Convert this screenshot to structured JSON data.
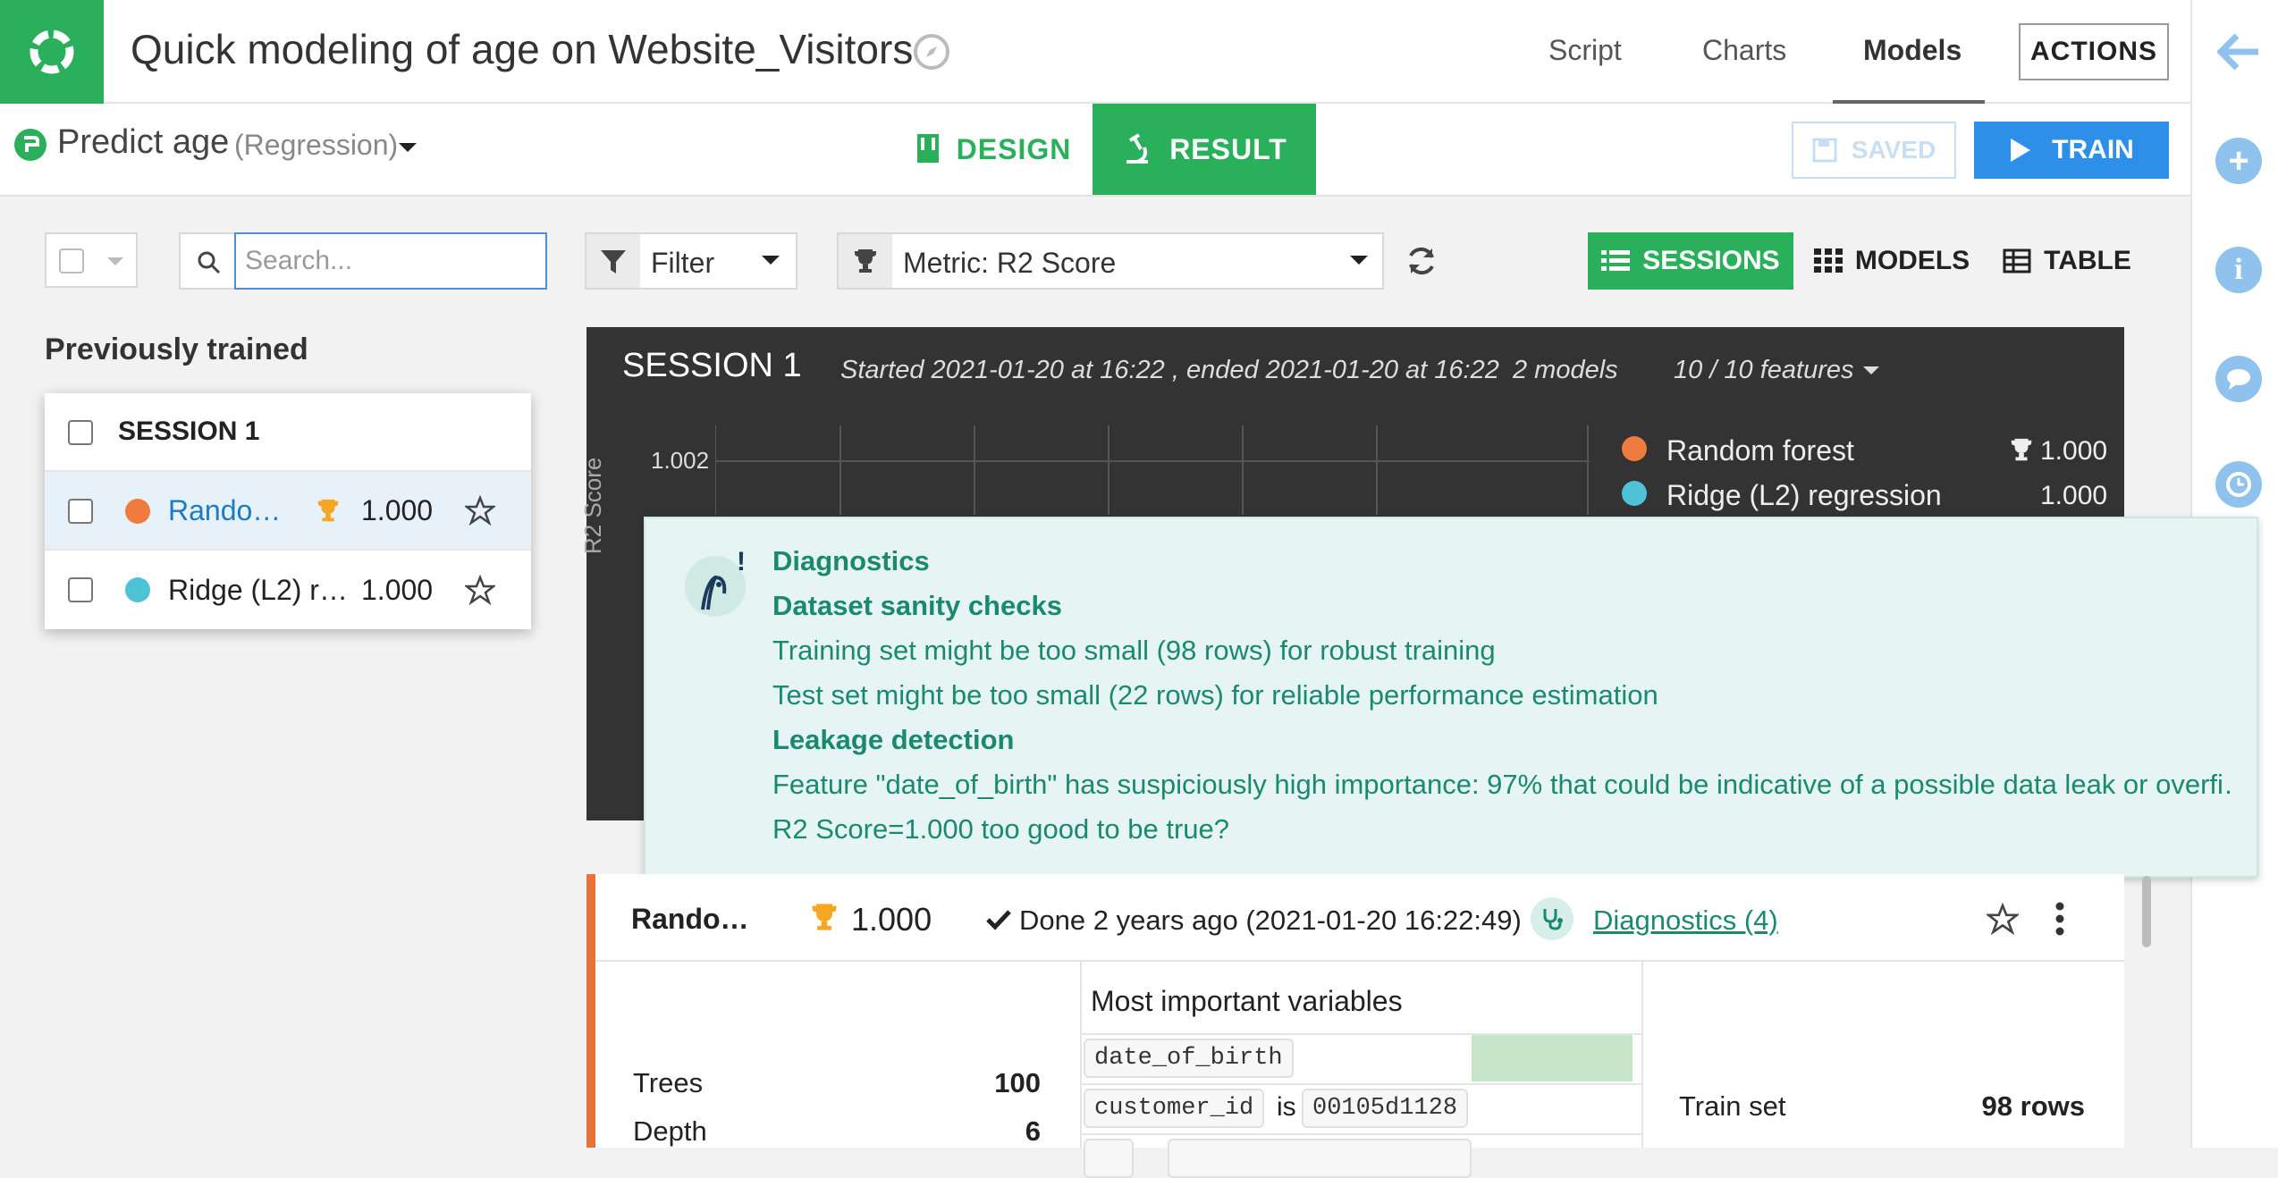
{
  "header": {
    "title": "Quick modeling of age on Website_Visitors",
    "nav": [
      "Script",
      "Charts",
      "Models"
    ],
    "actions_label": "ACTIONS"
  },
  "subheader": {
    "task_title": "Predict age",
    "task_type": "(Regression)",
    "design_label": "DESIGN",
    "result_label": "RESULT",
    "saved_label": "SAVED",
    "train_label": "TRAIN"
  },
  "toolbar": {
    "search_placeholder": "Search...",
    "filter_label": "Filter",
    "metric_label": "Metric: R2 Score",
    "sessions_label": "SESSIONS",
    "models_label": "MODELS",
    "table_label": "TABLE"
  },
  "left_panel": {
    "heading": "Previously trained",
    "session_label": "SESSION 1",
    "models": [
      {
        "name": "Rando…",
        "score": "1.000",
        "color": "#f07b3f",
        "best": true
      },
      {
        "name": "Ridge (L2) r…",
        "score": "1.000",
        "color": "#4fc3d6",
        "best": false
      }
    ]
  },
  "session": {
    "title": "SESSION 1",
    "time": "Started 2021-01-20 at 16:22 , ended 2021-01-20 at 16:22",
    "model_count": "2 models",
    "features": "10 / 10 features",
    "y_tick": "1.002",
    "y_label": "R2 Score",
    "legend": [
      {
        "name": "Random forest",
        "value": "1.000",
        "color": "#f07b3f"
      },
      {
        "name": "Ridge (L2) regression",
        "value": "1.000",
        "color": "#4fc3d6"
      }
    ]
  },
  "diagnostics": {
    "heading": "Diagnostics",
    "section1": "Dataset sanity checks",
    "line1": "Training set might be too small (98 rows) for robust training",
    "line2": "Test set might be too small (22 rows) for reliable performance estimation",
    "section2": "Leakage detection",
    "line3": "Feature \"date_of_birth\" has suspiciously high importance: 97% that could be indicative of a possible data leak or overfi…",
    "line4": "R2 Score=1.000 too good to be true?"
  },
  "model_card": {
    "name": "Rando…",
    "score": "1.000",
    "status": "Done 2 years ago (2021-01-20 16:22:49)",
    "diagnostics_link": "Diagnostics (4)",
    "params": [
      {
        "key": "Trees",
        "value": "100"
      },
      {
        "key": "Depth",
        "value": "6"
      }
    ],
    "miv_title": "Most important variables",
    "miv_var1": "date_of_birth",
    "miv_var2": "customer_id",
    "miv_is": "is",
    "miv_val2": "00105d1128",
    "train_set_label": "Train set",
    "train_set_value": "98 rows"
  }
}
